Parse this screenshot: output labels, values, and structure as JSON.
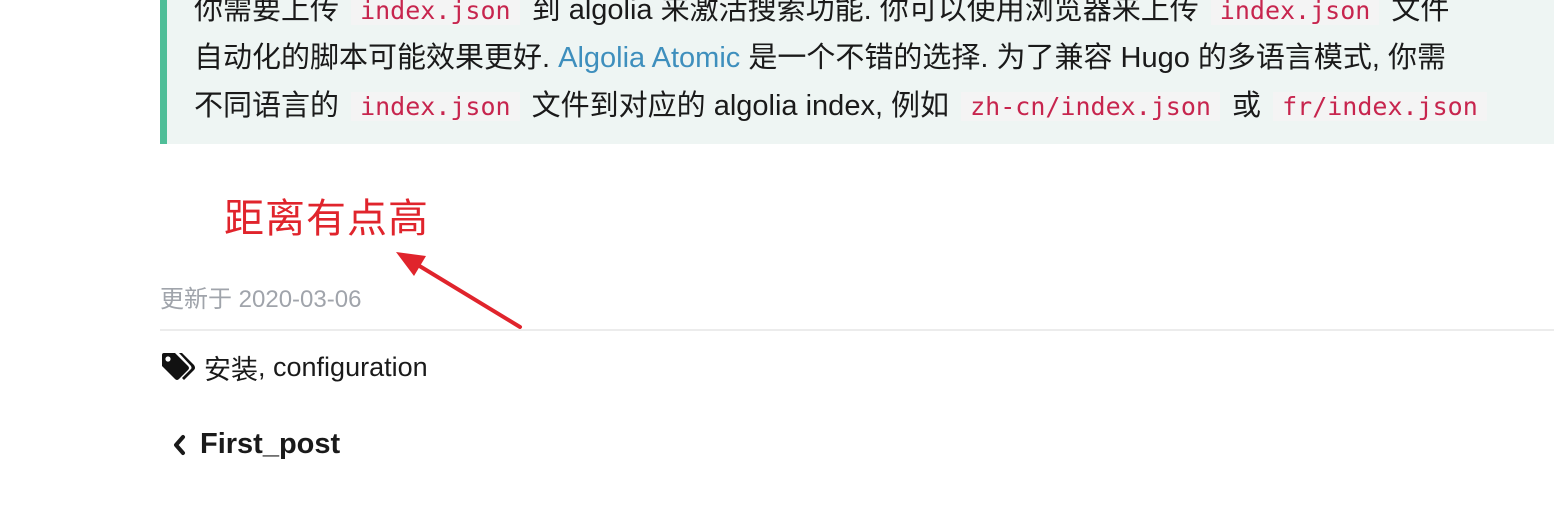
{
  "admonition": {
    "line1": {
      "t1": "你需要上传",
      "c1": "index.json",
      "t2": "到 algolia 来激活搜索功能. 你可以使用浏览器来上传",
      "c2": "index.json",
      "t3": "文件"
    },
    "line2": {
      "t1": "自动化的脚本可能效果更好.",
      "link": "Algolia Atomic",
      "t2": "是一个不错的选择. 为了兼容 Hugo 的多语言模式, 你需"
    },
    "line3": {
      "t1": "不同语言的",
      "c1": "index.json",
      "t2": "文件到对应的 algolia index, 例如",
      "c2": "zh-cn/index.json",
      "t3": "或",
      "c3": "fr/index.json"
    }
  },
  "annotation": {
    "text": "距离有点高",
    "color": "#e0242c"
  },
  "post_meta": {
    "updated": "更新于 2020-03-06",
    "tags_prefix_icon": "tags-icon",
    "tag1": "安装",
    "separator": ", ",
    "tag2": "configuration"
  },
  "post_nav": {
    "prev_icon": "chevron-left-icon",
    "prev_label": "First_post"
  },
  "colors": {
    "accent_border": "#4fbe98",
    "admonition_bg": "#eef5f3",
    "code_text": "#c7254e",
    "link": "#3e8fbd",
    "meta_gray": "#a0a4ab"
  }
}
